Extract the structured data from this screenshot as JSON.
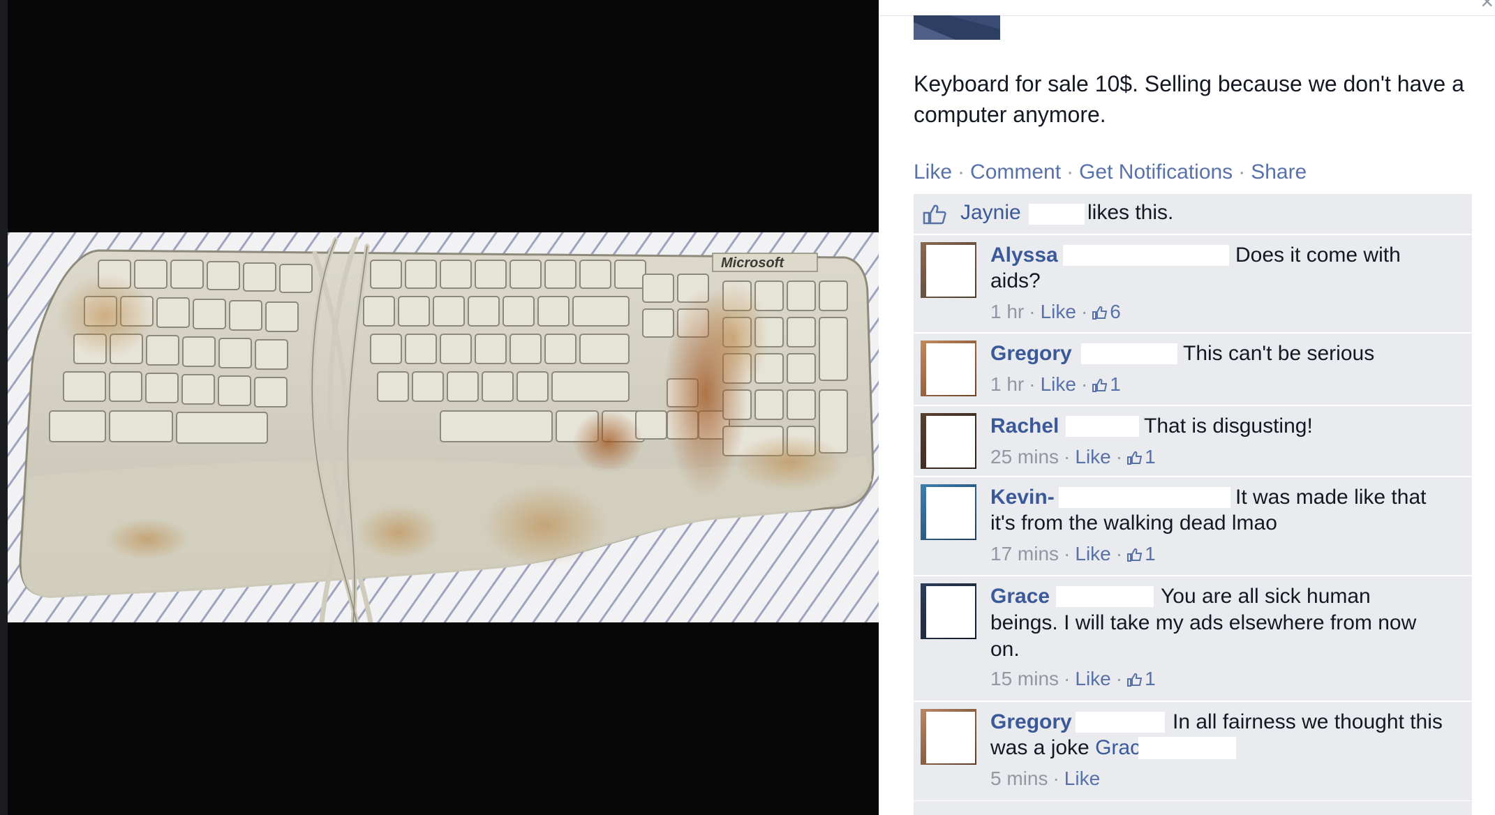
{
  "post": {
    "text": "Keyboard for sale 10$. Selling because we don't have a computer anymore."
  },
  "actions": {
    "like": "Like",
    "comment": "Comment",
    "notifications": "Get Notifications",
    "share": "Share",
    "separator": "·"
  },
  "likes": {
    "name": "Jaynie",
    "text": "likes this."
  },
  "comments": [
    {
      "name": "Alyssa",
      "line1": "Does it come with",
      "line2": "aids?",
      "time": "1 hr",
      "like": "Like",
      "count": "6"
    },
    {
      "name": "Gregory",
      "line1": "This can't be serious",
      "time": "1 hr",
      "like": "Like",
      "count": "1"
    },
    {
      "name": "Rachel",
      "line1": "That is disgusting!",
      "time": "25 mins",
      "like": "Like",
      "count": "1"
    },
    {
      "name": "Kevin-",
      "line1": "It was made like that",
      "line2": "it's from the walking dead lmao",
      "time": "17 mins",
      "like": "Like",
      "count": "1"
    },
    {
      "name": "Grace",
      "line1": "You are all sick human",
      "line2": "beings. I will take my ads elsewhere from now",
      "line3": "on.",
      "time": "15 mins",
      "like": "Like",
      "count": "1"
    },
    {
      "name": "Gregory",
      "line1": "In all fairness we thought this",
      "line2": "was a joke",
      "mention": "Grace",
      "time": "5 mins",
      "like": "Like"
    }
  ],
  "photo": {
    "brand": "Microsoft"
  },
  "colors": {
    "link": "#3b5998",
    "ufi_background": "#e9ebee",
    "meta_text": "#9197a3",
    "photo_background": "#070708"
  }
}
